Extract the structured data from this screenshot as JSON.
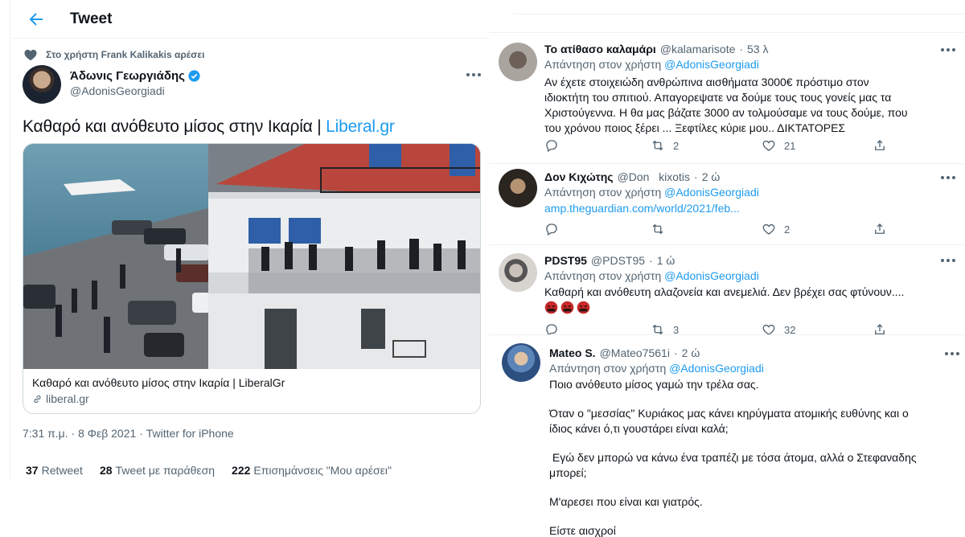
{
  "header": {
    "title": "Tweet"
  },
  "main_tweet": {
    "liked_by": "Στο χρήστη Frank Kalikakis αρέσει",
    "author_name": "Άδωνις Γεωργιάδης",
    "author_handle": "@AdonisGeorgiadi",
    "text": "Καθαρό και ανόθευτο μίσος στην Ικαρία | ",
    "text_link": "Liberal.gr",
    "card": {
      "title": "Καθαρό και ανόθευτο μίσος στην Ικαρία | LiberalGr",
      "domain": "liberal.gr"
    },
    "time": "7:31 π.μ.",
    "date": "8 Φεβ 2021",
    "source": "Twitter for iPhone",
    "stats": {
      "retweets_count": "37",
      "retweets_label": "Retweet",
      "quotes_count": "28",
      "quotes_label": "Tweet με παράθεση",
      "likes_count": "222",
      "likes_label": "Επισημάνσεις \"Μου αρέσει\""
    }
  },
  "reply_prefix": "Απάντηση στον χρήστη",
  "replies": [
    {
      "name": "Το ατίθασο καλαμάρι",
      "handle": "@kalamarisote",
      "time": "53 λ",
      "reply_to": "@AdonisGeorgiadi",
      "lines": [
        "Αν έχετε στοιχειώδη ανθρώπινα αισθήματα 3000€ πρόστιμο στον",
        "ιδιοκτήτη του σπιτιού. Απαγορεψατε να δούμε τους τους γονείς μας τα",
        "Χριστούγεννα. Η θα μας βάζατε 3000 αν τολμούσαμε να τους δούμε, που",
        "του χρόνου ποιος ξέρει ... Ξεφτίλες κύριε μου.. ΔΙΚΤΑΤΟΡΕΣ"
      ],
      "replies_count": "",
      "retweets_count": "2",
      "likes_count": "21"
    },
    {
      "name": "Δον Κιχώτης",
      "handle": "@Don   kixotis",
      "time": "2 ώ",
      "reply_to": "@AdonisGeorgiadi",
      "link": "amp.theguardian.com/world/2021/feb...",
      "replies_count": "",
      "retweets_count": "",
      "likes_count": "2"
    },
    {
      "name": "PDST95",
      "handle": "@PDST95",
      "time": "1 ώ",
      "reply_to": "@AdonisGeorgiadi",
      "lines": [
        "Καθαρή και ανόθευτη αλαζονεία και ανεμελιά. Δεν βρέχει σας φτύνουν...."
      ],
      "emoji": "angry-face-icon",
      "replies_count": "",
      "retweets_count": "3",
      "likes_count": "32"
    },
    {
      "name": "Mateo S.",
      "handle": "@Mateo7561i",
      "time": "2 ώ",
      "reply_to": "@AdonisGeorgiadi",
      "lines": [
        "Ποιο ανόθευτο μίσος γαμώ την τρέλα σας.",
        "",
        "Όταν ο \"μεσσίας\" Κυριάκος μας κάνει κηρύγματα ατομικής ευθύνης και ο",
        "ίδιος κάνει ό,τι γουστάρει είναι καλά;",
        "",
        " Εγώ δεν μπορώ να κάνω ένα τραπέζι με τόσα άτομα, αλλά ο Στεφαναδης",
        "μπορεί;",
        "",
        "Μ'αρεσει που είναι και γιατρός.",
        "",
        "Είστε αισχροί"
      ]
    }
  ],
  "colors": {
    "accent": "#1d9bf0",
    "text": "#0f1419",
    "muted": "#536471",
    "border": "#eff3f4"
  }
}
